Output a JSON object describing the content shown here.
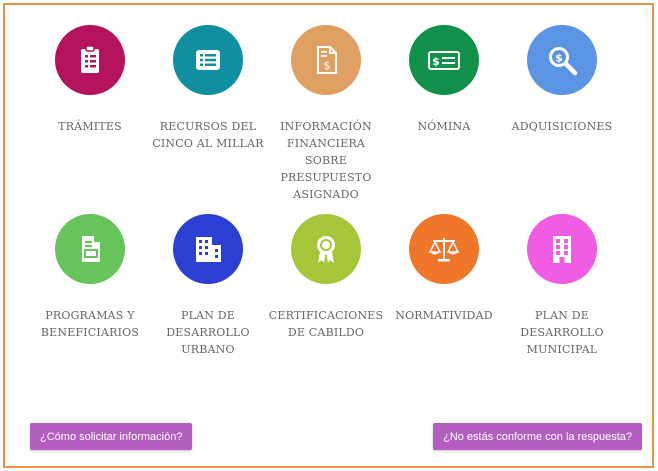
{
  "row1": [
    {
      "label": "TRÁMITES",
      "color": "#b5135b",
      "icon": "clipboard-icon"
    },
    {
      "label": "RECURSOS DEL CINCO AL MILLAR",
      "color": "#0f8f9f",
      "icon": "list-icon"
    },
    {
      "label": "INFORMACIÓN FINANCIERA SOBRE PRESUPUESTO ASIGNADO",
      "color": "#e0a062",
      "icon": "budget-document-icon"
    },
    {
      "label": "NÓMINA",
      "color": "#12914a",
      "icon": "payroll-bill-icon"
    },
    {
      "label": "ADQUISICIONES",
      "color": "#5b94e3",
      "icon": "money-search-icon"
    }
  ],
  "row2": [
    {
      "label": "PROGRAMAS Y BENEFICIARIOS",
      "color": "#66c45a",
      "icon": "document-icon"
    },
    {
      "label": "PLAN DE DESARROLLO URBANO",
      "color": "#2c3fd3",
      "icon": "buildings-icon"
    },
    {
      "label": "CERTIFICACIONES DE CABILDO",
      "color": "#a6c63a",
      "icon": "award-ribbon-icon"
    },
    {
      "label": "NORMATIVIDAD",
      "color": "#f0772a",
      "icon": "scales-icon"
    },
    {
      "label": "PLAN DE DESARROLLO MUNICIPAL",
      "color": "#f05de3",
      "icon": "office-building-icon"
    }
  ],
  "buttons": {
    "how_to_request": "¿Cómo solicitar información?",
    "not_satisfied": "¿No estás conforme con la respuesta?"
  }
}
